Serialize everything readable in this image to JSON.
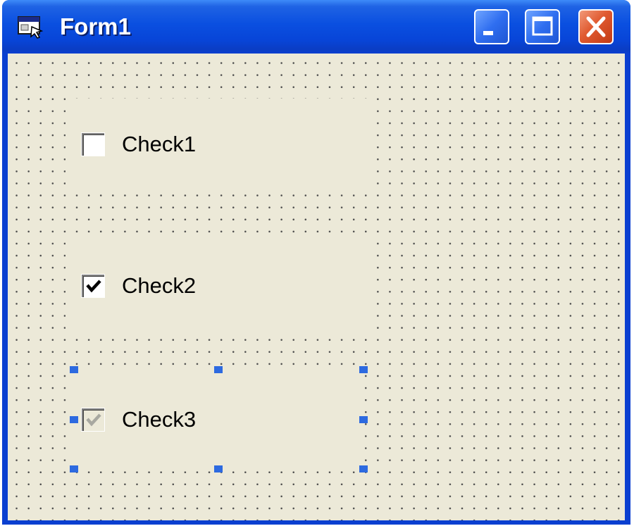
{
  "window": {
    "title": "Form1",
    "app_icon": "form-window-icon",
    "controls": {
      "minimize_icon": "minimize-icon",
      "maximize_icon": "maximize-icon",
      "close_icon": "close-icon"
    }
  },
  "form": {
    "checkboxes": [
      {
        "label": "Check1",
        "checked": false,
        "enabled": true
      },
      {
        "label": "Check2",
        "checked": true,
        "enabled": true
      },
      {
        "label": "Check3",
        "checked": true,
        "enabled": false,
        "selected": true
      }
    ]
  }
}
